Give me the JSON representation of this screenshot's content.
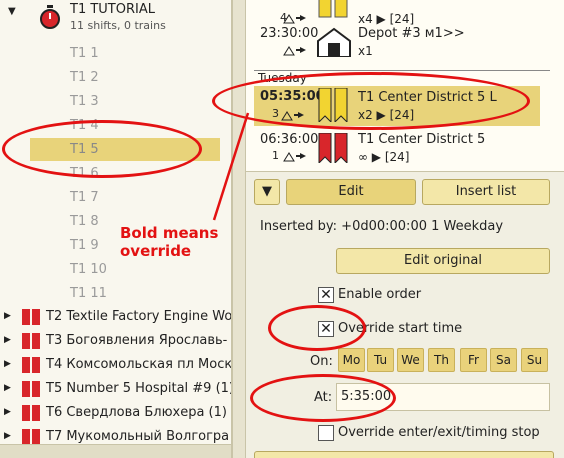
{
  "tree": {
    "root_title": "T1 TUTORIAL",
    "root_subtitle": "11 shifts, 0 trains",
    "shifts": [
      "T1 1",
      "T1 2",
      "T1 3",
      "T1 4",
      "T1 5",
      "T1 6",
      "T1 7",
      "T1 8",
      "T1 9",
      "T1 10",
      "T1 11"
    ],
    "lines": [
      "T2 Textile Factory Engine Wor",
      "T3 Богоявления Ярославь-",
      "T4 Комсомольская пл Моск",
      "T5 Number 5 Hospital #9 (1)",
      "T6 Свердлова Блюхера (1)",
      "T7 Мукомольный Волгогра"
    ]
  },
  "orders": [
    {
      "time": "",
      "count_prefix": "4",
      "name": "",
      "count": "x4 ▶ [24]"
    },
    {
      "time": "23:30:00",
      "count_prefix": "",
      "name": "Depot #3 м1>>",
      "count": "x1"
    },
    {
      "day_label": "Tuesday"
    },
    {
      "time": "05:35:00",
      "count_prefix": "3",
      "name": "T1 Center District 5 L",
      "count": "x2 ▶ [24]"
    },
    {
      "time": "06:36:00",
      "count_prefix": "1",
      "name": "T1 Center District 5",
      "count": "∞ ▶ [24]"
    }
  ],
  "controls": {
    "edit_label": "Edit",
    "insert_list_label": "Insert list",
    "inserted_by": "Inserted by: +0d00:00:00 1 Weekday",
    "edit_original_label": "Edit original",
    "enable_order_label": "Enable order",
    "override_start_label": "Override start time",
    "on_label": "On:",
    "days": [
      "Mo",
      "Tu",
      "We",
      "Th",
      "Fr",
      "Sa",
      "Su"
    ],
    "at_label": "At:",
    "at_value": "5:35:00",
    "override_enter_label": "Override enter/exit/timing stop"
  },
  "annotation": {
    "text_line1": "Bold means",
    "text_line2": "override"
  },
  "colors": {
    "accent": "#e8d37a",
    "annotation": "#e31212",
    "route_red": "#d8262b",
    "route_yellow": "#f2d431"
  }
}
